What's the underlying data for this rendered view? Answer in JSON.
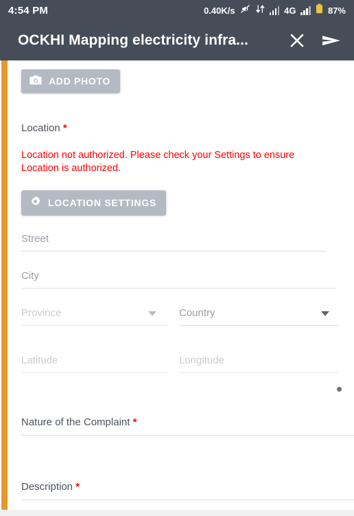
{
  "status_bar": {
    "time": "4:54 PM",
    "network_speed": "0.40K/s",
    "mute_icon": "mute-crossed-icon",
    "sync_icon": "data-transfer-icon",
    "signal_icon_1": "signal-bars-icon",
    "network_type": "4G",
    "signal_icon_2": "signal-bars-icon",
    "battery_icon": "battery-icon",
    "battery_percent": "87%"
  },
  "app_bar": {
    "title": "OCKHI Mapping electricity infra...",
    "close_icon": "close-icon",
    "send_icon": "send-icon"
  },
  "form": {
    "add_photo_button": {
      "label": "ADD PHOTO",
      "icon": "camera-icon"
    },
    "location_label": "Location",
    "location_required": "*",
    "location_error": "Location not authorized. Please check your Settings to ensure Location is authorized.",
    "location_settings_button": {
      "label": "LOCATION SETTINGS",
      "icon": "gear-icon"
    },
    "fields": {
      "street": {
        "placeholder": "Street",
        "value": ""
      },
      "city": {
        "placeholder": "City",
        "value": ""
      },
      "province": {
        "placeholder": "Province",
        "value": ""
      },
      "country": {
        "placeholder": "Country",
        "value": ""
      },
      "latitude": {
        "placeholder": "Latitude",
        "value": ""
      },
      "longitude": {
        "placeholder": "Longitude",
        "value": ""
      }
    },
    "nature_label": "Nature of the Complaint",
    "nature_required": "*",
    "nature_value": "",
    "description_label": "Description",
    "description_required": "*",
    "description_value": ""
  },
  "colors": {
    "header_bg": "#454d58",
    "accent_orange": "#e8982b",
    "button_gray": "#b3bac3",
    "error_red": "#ff0000",
    "battery_yellow": "#e8c33c"
  }
}
